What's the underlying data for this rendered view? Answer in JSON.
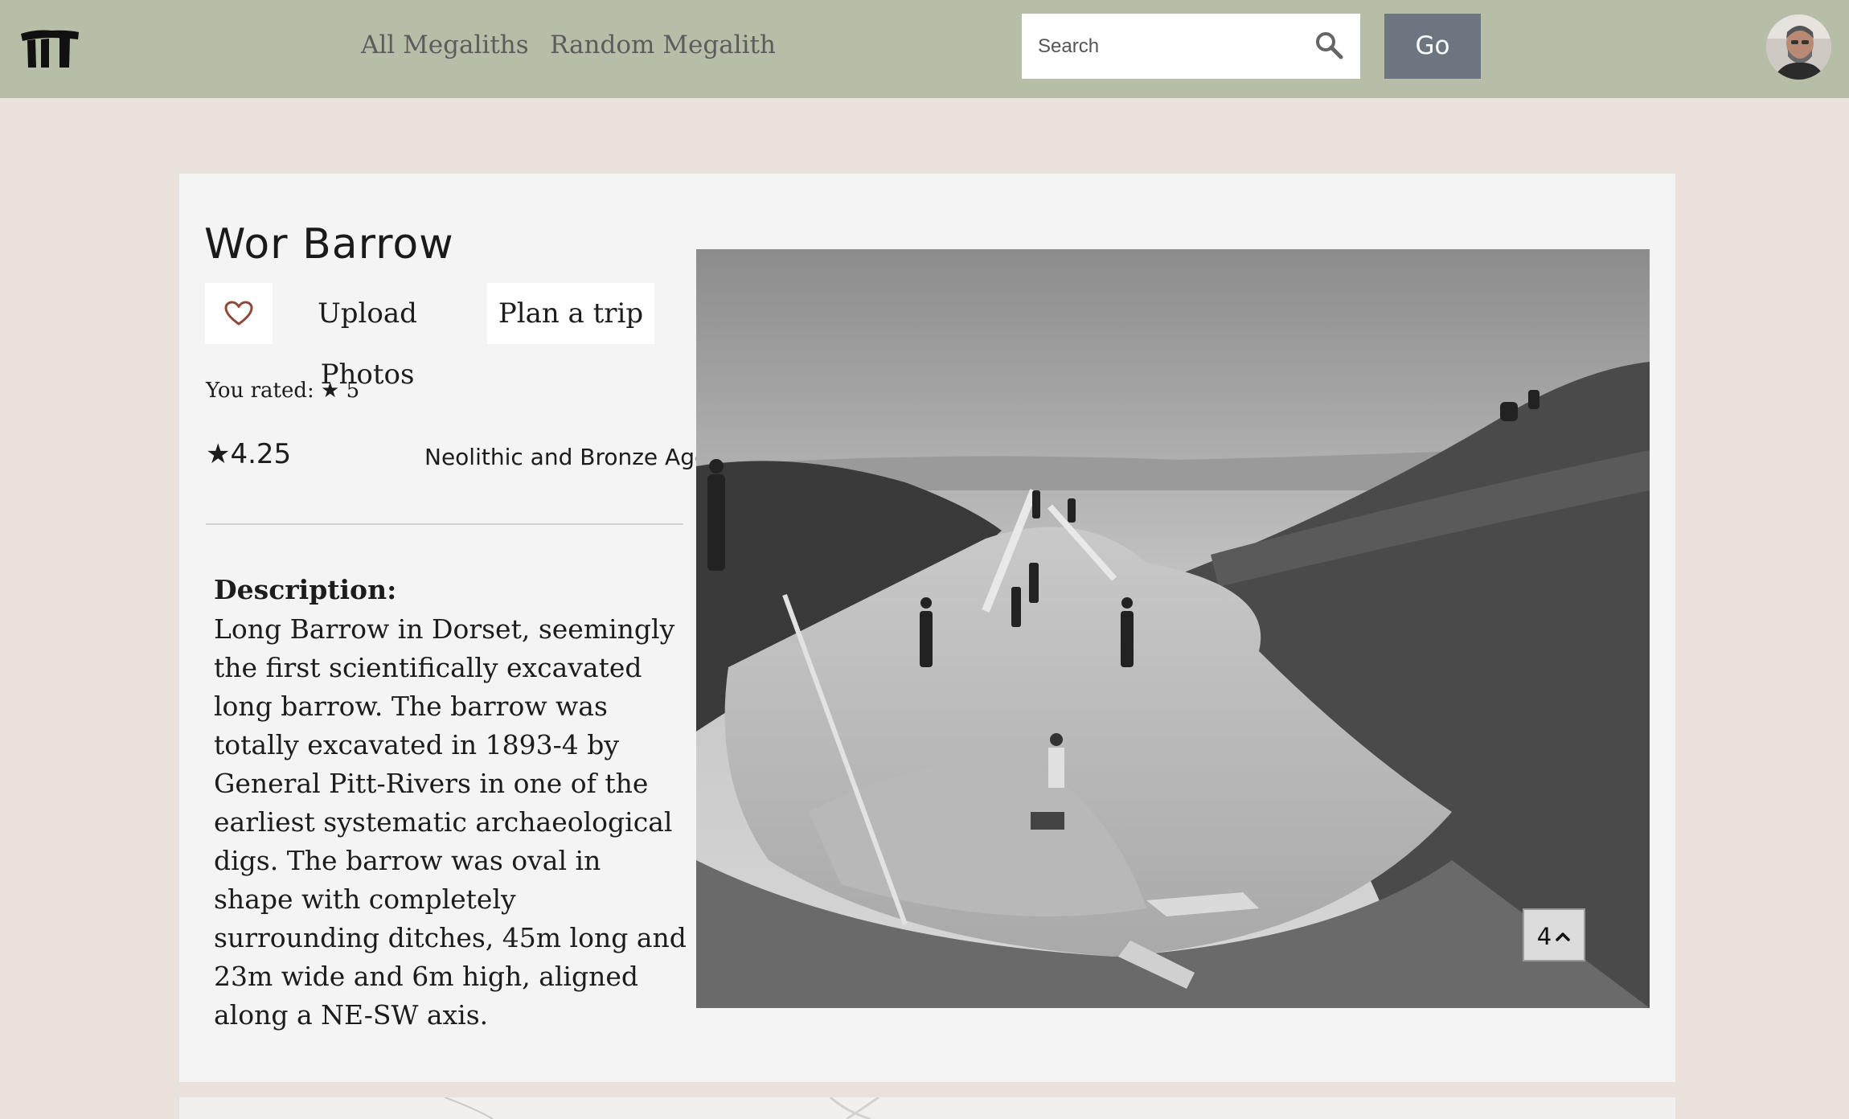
{
  "header": {
    "logo_name": "megalith-logo-icon",
    "nav": [
      {
        "label": "All Megaliths"
      },
      {
        "label": "Random Megalith"
      }
    ],
    "search": {
      "placeholder": "Search"
    },
    "go_label": "Go"
  },
  "site": {
    "title": "Wor Barrow",
    "upload_label": "Upload Photos",
    "plan_label": "Plan a trip",
    "user_rating_text": "You rated: ★ 5",
    "average_rating_text": "★4.25",
    "period": "Neolithic and Bronze Age",
    "description_heading": "Description:",
    "description": "Long Barrow in Dorset, seemingly the first scientifically excavated long barrow. The barrow was totally excavated in 1893-4 by General Pitt-Rivers in one of the earliest systematic archaeological digs. The barrow was oval in shape with completely surrounding ditches, 45m long and 23m wide and 6m high, aligned along a NE-SW axis.",
    "photo_count": "4"
  },
  "colors": {
    "header_bg": "#b7bea8",
    "page_bg": "#e9e1dc",
    "card_bg": "#f4f4f4",
    "go_button_bg": "#6d7680",
    "heart": "#8b4a3a"
  }
}
